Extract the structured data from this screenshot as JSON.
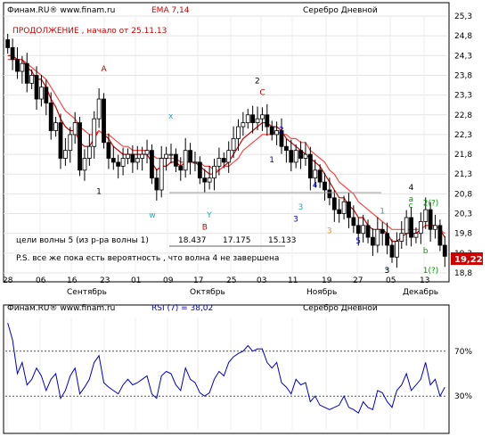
{
  "top_panel": {
    "source": "Финам.RU® www.finam.ru",
    "indicator": "EMA 7,14",
    "instrument": "Серебро Дневной",
    "status_note": "ПРОДОЛЖЕНИЕ  , начало от  25.11.13",
    "targets_label": "цели волны 5 (из р-ра волны 1)",
    "target_values": [
      "18.437",
      "17.175",
      "15.133"
    ],
    "ps_note": "P.S. все  же пока  есть  вероятность , что  волна 4  не завершена",
    "last_price": "19,22",
    "colors": {
      "up_candle": "#ffffff",
      "down_candle": "#000000",
      "ema_fast": "#cc0000",
      "ema_slow": "#ff4444",
      "price_box": "#cc0000"
    }
  },
  "bottom_panel": {
    "source": "Финам.RU® www.finam.ru",
    "indicator": "RSI (7) = 38,02",
    "instrument": "Серебро Дневной",
    "colors": {
      "rsi_line": "#0000cc"
    }
  },
  "chart_data": [
    {
      "type": "candlestick",
      "title": "Серебро Дневной",
      "y_ticks": [
        "25,3",
        "24,8",
        "24,3",
        "23,8",
        "23,3",
        "22,8",
        "22,3",
        "21,8",
        "21,3",
        "20,8",
        "20,3",
        "19,8",
        "19,3",
        "18,8"
      ],
      "ylim": [
        18.8,
        25.3
      ],
      "x_ticks": [
        "28",
        "06",
        "16",
        "23",
        "01",
        "09",
        "17",
        "25",
        "03",
        "11",
        "19",
        "27",
        "05",
        "13"
      ],
      "month_labels": [
        "Сентябрь",
        "Октябрь",
        "Ноябрь",
        "Декабрь"
      ],
      "grid": true,
      "close": [
        24.5,
        24.2,
        23.9,
        24.1,
        23.6,
        23.8,
        23.2,
        23.5,
        23.1,
        22.4,
        22.6,
        21.7,
        21.9,
        22.3,
        22.6,
        21.4,
        21.7,
        22.0,
        22.7,
        23.2,
        22.1,
        21.7,
        21.6,
        21.5,
        21.7,
        21.8,
        21.6,
        21.7,
        21.8,
        21.9,
        21.2,
        20.9,
        21.7,
        21.8,
        21.8,
        21.5,
        21.4,
        21.9,
        21.6,
        21.6,
        21.2,
        21.1,
        21.2,
        21.5,
        21.7,
        21.6,
        21.9,
        22.2,
        22.5,
        22.6,
        22.8,
        22.6,
        22.7,
        22.8,
        22.5,
        22.3,
        22.4,
        22.0,
        21.9,
        21.6,
        21.9,
        21.7,
        21.8,
        21.2,
        21.4,
        21.1,
        20.9,
        20.7,
        20.4,
        20.3,
        20.6,
        20.2,
        20.0,
        19.8,
        20.0,
        19.7,
        19.5,
        19.9,
        19.8,
        19.5,
        19.2,
        19.6,
        19.8,
        20.2,
        19.7,
        19.8,
        20.1,
        20.4,
        19.9,
        20.0,
        19.5,
        19.22
      ],
      "ema": [
        {
          "name": "EMA 7",
          "color": "#cc0000",
          "values": [
            24.3,
            24.3,
            24.2,
            24.2,
            24.0,
            23.9,
            23.7,
            23.7,
            23.5,
            23.2,
            23.0,
            22.7,
            22.5,
            22.4,
            22.4,
            22.1,
            22.0,
            22.0,
            22.2,
            22.4,
            22.3,
            22.2,
            22.0,
            21.9,
            21.8,
            21.8,
            21.8,
            21.8,
            21.8,
            21.8,
            21.6,
            21.4,
            21.5,
            21.5,
            21.6,
            21.6,
            21.5,
            21.6,
            21.6,
            21.6,
            21.5,
            21.4,
            21.3,
            21.3,
            21.4,
            21.5,
            21.6,
            21.8,
            22.0,
            22.2,
            22.3,
            22.4,
            22.5,
            22.6,
            22.6,
            22.5,
            22.5,
            22.4,
            22.2,
            22.1,
            22.0,
            21.9,
            21.8,
            21.7,
            21.6,
            21.5,
            21.3,
            21.1,
            20.9,
            20.7,
            20.7,
            20.5,
            20.4,
            20.2,
            20.2,
            20.0,
            19.9,
            19.9,
            19.9,
            19.8,
            19.6,
            19.6,
            19.7,
            19.8,
            19.8,
            19.8,
            19.9,
            20.0,
            20.0,
            20.0,
            19.9,
            19.7
          ]
        },
        {
          "name": "EMA 14",
          "color": "#ff4444",
          "values": [
            24.2,
            24.2,
            24.2,
            24.2,
            24.1,
            24.0,
            23.9,
            23.8,
            23.7,
            23.5,
            23.3,
            23.1,
            22.9,
            22.8,
            22.7,
            22.5,
            22.4,
            22.3,
            22.3,
            22.4,
            22.3,
            22.3,
            22.2,
            22.1,
            22.0,
            22.0,
            21.9,
            21.9,
            21.9,
            21.9,
            21.8,
            21.7,
            21.7,
            21.7,
            21.7,
            21.7,
            21.6,
            21.6,
            21.6,
            21.6,
            21.6,
            21.5,
            21.5,
            21.4,
            21.4,
            21.5,
            21.5,
            21.6,
            21.7,
            21.9,
            22.0,
            22.1,
            22.2,
            22.3,
            22.3,
            22.3,
            22.4,
            22.3,
            22.3,
            22.2,
            22.2,
            22.1,
            22.1,
            21.9,
            21.8,
            21.7,
            21.6,
            21.4,
            21.3,
            21.1,
            21.0,
            20.9,
            20.8,
            20.6,
            20.5,
            20.4,
            20.3,
            20.2,
            20.1,
            20.0,
            19.9,
            19.9,
            19.9,
            19.9,
            19.9,
            19.9,
            19.9,
            20.0,
            20.0,
            20.0,
            19.9,
            19.8
          ]
        }
      ],
      "wave_labels": [
        {
          "text": "A",
          "color": "#cc0000"
        },
        {
          "text": "1",
          "color": "#000000"
        },
        {
          "text": "x",
          "color": "#22aaaa"
        },
        {
          "text": "w",
          "color": "#22aaaa"
        },
        {
          "text": "Y",
          "color": "#22aaaa"
        },
        {
          "text": "B",
          "color": "#cc0000"
        },
        {
          "text": "2",
          "color": "#000000"
        },
        {
          "text": "C",
          "color": "#cc0000"
        },
        {
          "text": "1",
          "color": "#0000cc"
        },
        {
          "text": "2",
          "color": "#0000cc"
        },
        {
          "text": "3",
          "color": "#0000cc"
        },
        {
          "text": "4",
          "color": "#0000cc"
        },
        {
          "text": "5",
          "color": "#0000cc"
        },
        {
          "text": "3",
          "color": "#22aaaa"
        },
        {
          "text": "5",
          "color": "#22aaaa"
        },
        {
          "text": "1",
          "color": "#22aaaa"
        },
        {
          "text": "3",
          "color": "#ff8800"
        },
        {
          "text": "4",
          "color": "#000000"
        },
        {
          "text": "3",
          "color": "#000000"
        },
        {
          "text": "a",
          "color": "#009900"
        },
        {
          "text": "b",
          "color": "#009900"
        },
        {
          "text": "c",
          "color": "#009900"
        },
        {
          "text": "2(?)",
          "color": "#009900"
        },
        {
          "text": "1(?)",
          "color": "#009900"
        }
      ]
    },
    {
      "type": "line",
      "title": "RSI (7) = 38,02",
      "ylim": [
        0,
        100
      ],
      "levels": [
        {
          "value": 70,
          "label": "70%"
        },
        {
          "value": 30,
          "label": "30%"
        }
      ],
      "series": [
        {
          "name": "RSI (7)",
          "values": [
            95,
            80,
            50,
            60,
            40,
            45,
            55,
            48,
            35,
            45,
            50,
            28,
            35,
            48,
            55,
            32,
            38,
            45,
            60,
            66,
            42,
            38,
            35,
            32,
            40,
            45,
            40,
            42,
            45,
            48,
            32,
            28,
            48,
            52,
            50,
            40,
            35,
            55,
            45,
            42,
            33,
            30,
            33,
            45,
            52,
            48,
            60,
            65,
            68,
            70,
            75,
            70,
            72,
            72,
            60,
            55,
            60,
            42,
            38,
            32,
            45,
            40,
            42,
            25,
            30,
            22,
            20,
            18,
            20,
            22,
            30,
            20,
            18,
            15,
            25,
            20,
            18,
            35,
            33,
            25,
            20,
            35,
            40,
            50,
            35,
            40,
            45,
            60,
            40,
            45,
            30,
            38
          ]
        }
      ]
    }
  ]
}
